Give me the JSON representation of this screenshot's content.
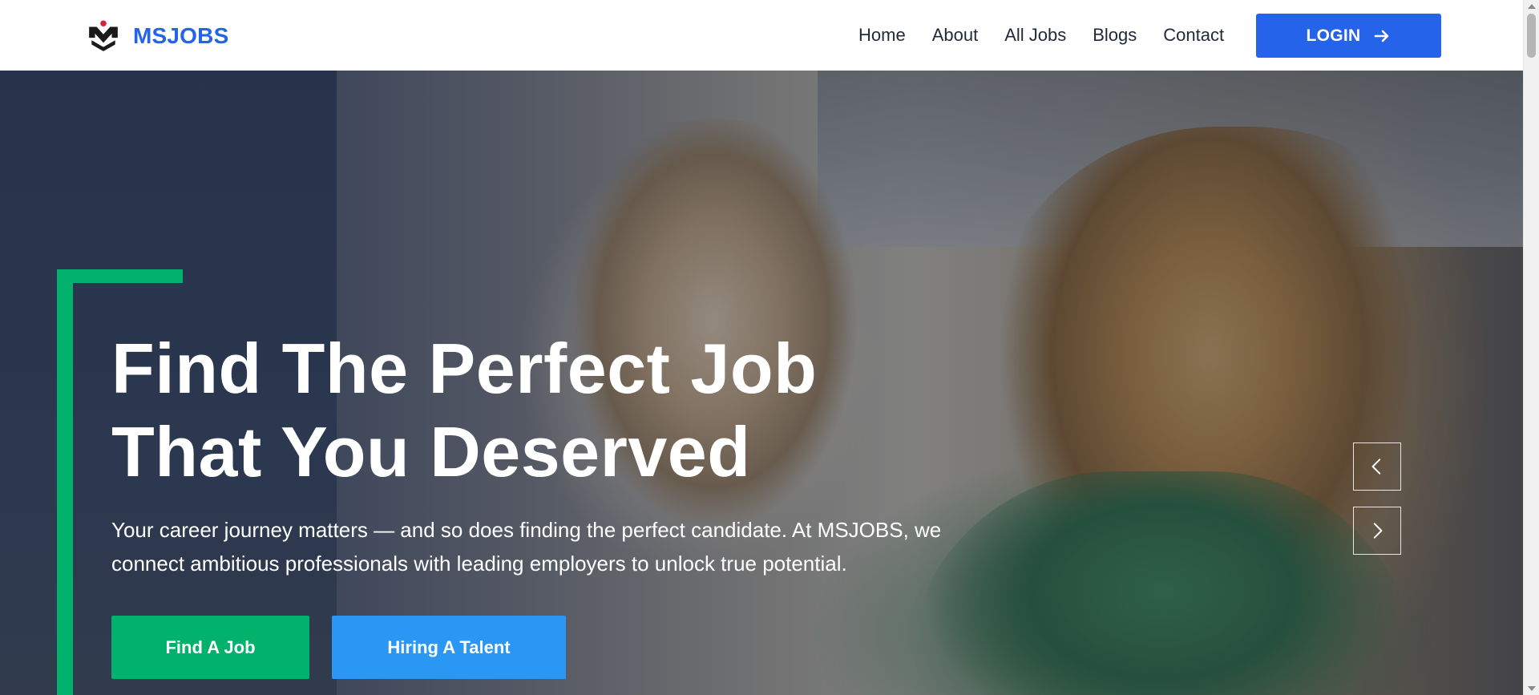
{
  "brand": {
    "name": "MSJOBS",
    "logo_icon": "msjobs-logo-icon",
    "color": "#2563eb"
  },
  "nav": {
    "items": [
      {
        "label": "Home"
      },
      {
        "label": "About"
      },
      {
        "label": "All Jobs"
      },
      {
        "label": "Blogs"
      },
      {
        "label": "Contact"
      }
    ],
    "login_label": "LOGIN",
    "login_icon": "arrow-right-icon"
  },
  "hero": {
    "title_line1": "Find The Perfect Job",
    "title_line2": "That You Deserved",
    "subtitle": "Your career journey matters — and so does finding the perfect candidate. At MSJOBS, we connect ambitious professionals with leading employers to unlock true potential.",
    "primary_cta": "Find A Job",
    "secondary_cta": "Hiring A Talent",
    "prev_icon": "chevron-left-icon",
    "next_icon": "chevron-right-icon"
  },
  "colors": {
    "accent_green": "#00b26c",
    "accent_blue": "#2b97f5",
    "login_blue": "#2563eb"
  }
}
